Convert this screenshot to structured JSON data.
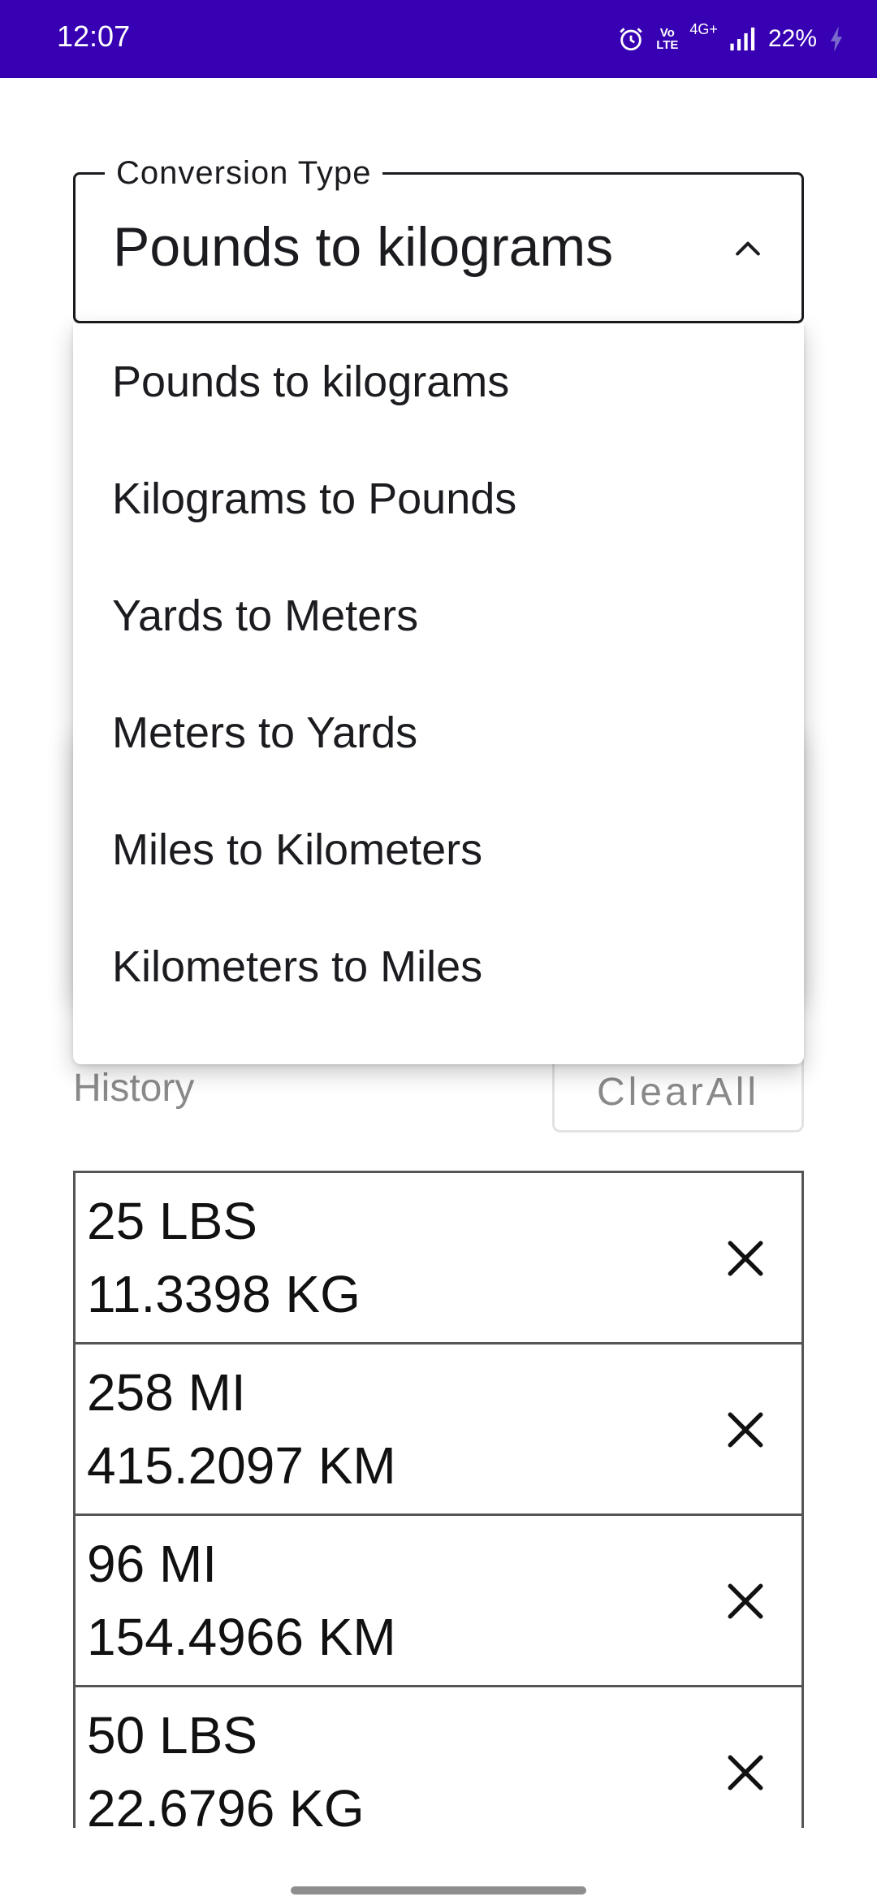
{
  "status_bar": {
    "time": "12:07",
    "volte_top": "Vo",
    "volte_bottom": "LTE",
    "network": "4G+",
    "battery": "22%",
    "icons": [
      "alarm-icon",
      "volte-icon",
      "signal-icon",
      "battery-charging-icon"
    ]
  },
  "conversion": {
    "label": "Conversion Type",
    "selected": "Pounds to kilograms",
    "options": [
      "Pounds to kilograms",
      "Kilograms to Pounds",
      "Yards to Meters",
      "Meters to Yards",
      "Miles to Kilometers",
      "Kilometers to Miles"
    ]
  },
  "history": {
    "label": "History",
    "clear_label": "ClearAll",
    "items": [
      {
        "input": "25 LBS",
        "output": "11.3398 KG"
      },
      {
        "input": "258 MI",
        "output": "415.2097 KM"
      },
      {
        "input": "96 MI",
        "output": "154.4966 KM"
      },
      {
        "input": "50 LBS",
        "output": "22.6796 KG"
      }
    ]
  },
  "colors": {
    "status_bar": "#3700b3",
    "text": "#1c1b1f",
    "muted": "#8a8a8a"
  }
}
